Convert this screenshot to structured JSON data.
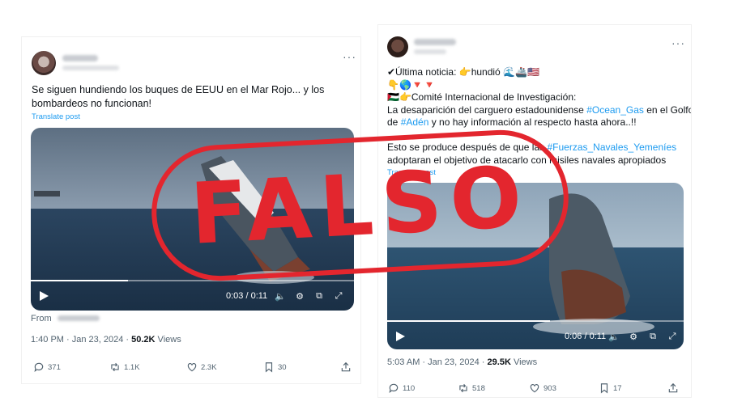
{
  "colors": {
    "link": "#1d9bf0",
    "stamp": "#e3262e",
    "muted": "#536471"
  },
  "left_post": {
    "text_lines": [
      "Se siguen hundiendo los buques de EEUU en el Mar Rojo... y los",
      "bombardeos no funcionan!"
    ],
    "translate": "Translate post",
    "video": {
      "time": "0:03 / 0:11",
      "progress": 0.3
    },
    "from_label": "From",
    "timestamp": "1:40 PM · Jan 23, 2024 · ",
    "views_count": "50.2K",
    "views_label": " Views",
    "actions": {
      "replies": "371",
      "reposts": "1.1K",
      "likes": "2.3K",
      "bookmarks": "30"
    },
    "icons": [
      "more-icon",
      "play-icon",
      "volume-icon",
      "settings-icon",
      "pip-icon",
      "fullscreen-icon",
      "reply-icon",
      "repost-icon",
      "like-icon",
      "bookmark-icon",
      "share-icon"
    ]
  },
  "right_post": {
    "line1_prefix": "✔Última noticia: 👉hundió 🌊🚢🇺🇸",
    "line2": "👇🌎🔻🔻",
    "line3": "🇵🇸👉Comité Internacional de Investigación:",
    "line4_a": "La desaparición del carguero estadounidense ",
    "line4_tag": "#Ocean_Gas",
    "line4_b": " en el Golfo",
    "line5_a": "de ",
    "line5_tag": "#Adén",
    "line5_b": " y no hay información al respecto hasta ahora..!!",
    "line6_a": "Esto se produce después de que las ",
    "line6_tag": "#Fuerzas_Navales_Yemeníes",
    "line7": "adoptaran el objetivo de atacarlo con misiles navales apropiados",
    "translate": "Translate post",
    "video": {
      "time": "0:06 / 0:11",
      "progress": 0.55
    },
    "timestamp": "5:03 AM · Jan 23, 2024 · ",
    "views_count": "29.5K",
    "views_label": " Views",
    "actions": {
      "replies": "110",
      "reposts": "518",
      "likes": "903",
      "bookmarks": "17"
    }
  },
  "stamp": {
    "text": "FALSO"
  }
}
